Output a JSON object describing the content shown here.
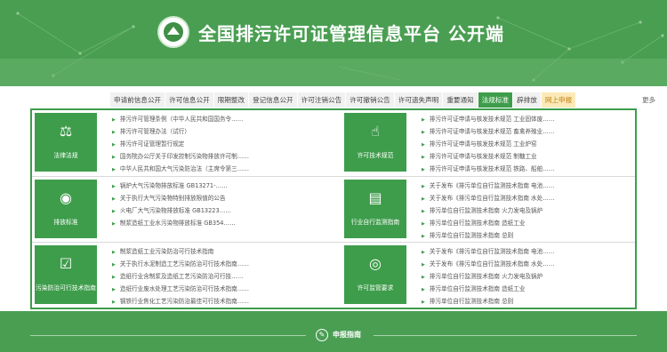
{
  "header": {
    "title": "全国排污许可证管理信息平台  公开端",
    "logo": "emblem-logo"
  },
  "nav": {
    "tabs": [
      {
        "label": "申请前信息公开"
      },
      {
        "label": "许可信息公开"
      },
      {
        "label": "限期整改"
      },
      {
        "label": "登记信息公开"
      },
      {
        "label": "许可注销公告"
      },
      {
        "label": "许可撤销公告"
      },
      {
        "label": "许可遗失声明"
      },
      {
        "label": "重要通知"
      },
      {
        "label": "法规标准",
        "state": "active"
      },
      {
        "label": "辟排放"
      },
      {
        "label": "网上申报",
        "state": "highlight"
      }
    ],
    "more": "更多"
  },
  "panels": [
    {
      "category": "法律法规",
      "icon": "scales-icon",
      "items": [
        "排污许可管理条例（中华人民共和国国务令……",
        "排污许可管理办法（试行）",
        "排污许可证管理暂行规定",
        "国务院办公厅关于印发控制污染物排放许可制……",
        "中华人民共和国大气污染防治法（主席令第三……"
      ]
    },
    {
      "category": "许可技术规范",
      "icon": "document-hand-icon",
      "items": [
        "排污许可证申请与核发技术规范 工业固体废……",
        "排污许可证申请与核发技术规范 畜禽养殖业……",
        "排污许可证申请与核发技术规范 工业炉窑",
        "排污许可证申请与核发技术规范 制糖工业",
        "排污许可证申请与核发技术规范 铁路、船舶……"
      ]
    },
    {
      "category": "排放标准",
      "icon": "target-icon",
      "items": [
        "锅炉大气污染物排放标准 GB13271-……",
        "关于执行大气污染物特别排放限值的公告",
        "火电厂大气污染物排放标准 GB13223……",
        "制浆造纸工业水污染物排放标准 GB354……"
      ]
    },
    {
      "category": "行业自行监测指南",
      "icon": "clipboard-icon",
      "items": [
        "关于发布《排污单位自行监测技术指南 电池……",
        "关于发布《排污单位自行监测技术指南 水处……",
        "排污单位自行监测技术指南 火力发电及锅炉",
        "排污单位自行监测技术指南 造纸工业",
        "排污单位自行监测技术指南 总则"
      ]
    },
    {
      "category": "污染防治可行技术指南",
      "icon": "clipboard-check-icon",
      "items": [
        "制浆造纸工业污染防治可行技术指南",
        "关于执行水泥制造工艺污染防治可行技术指南……",
        "造纸行业含制浆及造纸工艺污染防治可行技……",
        "造纸行业废水处理工艺污染防治可行技术指南……",
        "钢铁行业焦化工艺污染防治最佳可行技术指南……"
      ]
    },
    {
      "category": "许可监管要求",
      "icon": "eye-check-icon",
      "items": [
        "关于发布《排污单位自行监测技术指南 电池……",
        "关于发布《排污单位自行监测技术指南 水处……",
        "排污单位自行监测技术指南 火力发电及锅炉",
        "排污单位自行监测技术指南 造纸工业",
        "排污单位自行监测技术指南 总则"
      ]
    }
  ],
  "footer": {
    "guide_label": "申报指南",
    "guide_icon": "compass-icon"
  },
  "colors": {
    "brand_green": "#4a9e52",
    "accent_green": "#3e9d4b",
    "highlight_tab": "#fbe9b7"
  }
}
